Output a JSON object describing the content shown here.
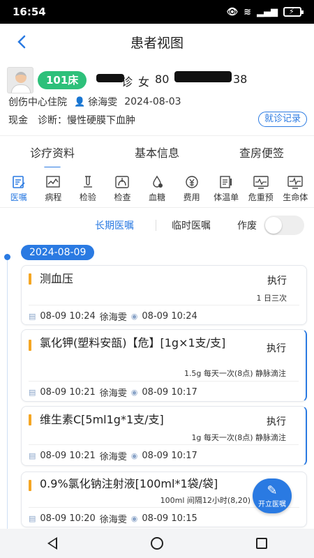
{
  "status": {
    "time": "16:54"
  },
  "nav": {
    "title": "患者视图"
  },
  "patient": {
    "bed": "101床",
    "name_partial": "诊",
    "gender": "女",
    "age": "80",
    "id_suffix": "38",
    "department": "创伤中心住院",
    "doctor": "徐海雯",
    "admit_date": "2024-08-03",
    "payment": "现金",
    "diagnosis_label": "诊断：",
    "diagnosis": "慢性硬膜下血肿",
    "visit_record_btn": "就诊记录"
  },
  "tabs": [
    {
      "label": "诊疗资料",
      "active": true
    },
    {
      "label": "基本信息",
      "active": false
    },
    {
      "label": "查房便签",
      "active": false
    }
  ],
  "icon_tabs": [
    {
      "label": "医嘱",
      "icon": "orders-icon",
      "active": true
    },
    {
      "label": "病程",
      "icon": "course-chart-icon",
      "active": false
    },
    {
      "label": "检验",
      "icon": "test-tube-icon",
      "active": false
    },
    {
      "label": "检查",
      "icon": "lungs-icon",
      "active": false
    },
    {
      "label": "血糖",
      "icon": "blood-drop-icon",
      "active": false
    },
    {
      "label": "费用",
      "icon": "yuan-icon",
      "active": false
    },
    {
      "label": "体温单",
      "icon": "temperature-sheet-icon",
      "active": false
    },
    {
      "label": "危重预",
      "icon": "critical-monitor-icon",
      "active": false
    },
    {
      "label": "生命体",
      "icon": "vital-signs-icon",
      "active": false
    }
  ],
  "subtabs": {
    "long_term": "长期医嘱",
    "temporary": "临时医嘱",
    "discarded": "作废",
    "discarded_on": false
  },
  "timeline": {
    "date": "2024-08-09",
    "orders": [
      {
        "name": "测血压",
        "status": "执行",
        "dose": "1 日三次",
        "created": "08-09 10:24",
        "creator": "徐海雯",
        "executed": "08-09 10:24"
      },
      {
        "name": "氯化钾(塑料安瓿)【危】[1g×1支/支]",
        "status": "执行",
        "dose": "1.5g 每天一次(8点) 静脉滴注",
        "created": "08-09 10:21",
        "creator": "徐海雯",
        "executed": "08-09 10:17"
      },
      {
        "name": "维生素C[5ml1g*1支/支]",
        "status": "执行",
        "dose": "1g 每天一次(8点) 静脉滴注",
        "created": "08-09 10:21",
        "creator": "徐海雯",
        "executed": "08-09 10:17"
      },
      {
        "name": "0.9%氯化钠注射液[100ml*1袋/袋]",
        "status": "",
        "dose": "100ml 间隔12小时(8,20)",
        "created": "08-09 10:20",
        "creator": "徐海雯",
        "executed": "08-09 10:15"
      }
    ]
  },
  "fab": {
    "label": "开立医嘱"
  }
}
